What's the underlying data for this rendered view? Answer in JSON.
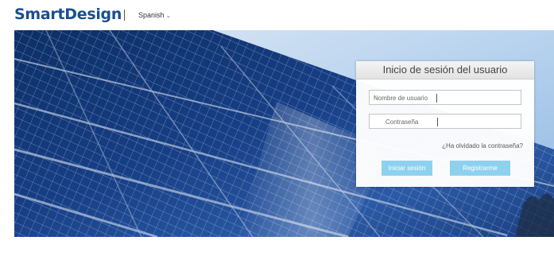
{
  "header": {
    "logo_text": "SmartDesign",
    "language": "Spanish",
    "language_chevron": "⌄"
  },
  "login": {
    "title": "Inicio de sesión del usuario",
    "username_placeholder": "Nombre de usuario",
    "password_placeholder": "Contraseña",
    "forgot_password": "¿Ha olvidado la contraseña?",
    "login_button": "Iniciar sesión",
    "register_button": "Registrarme"
  },
  "colors": {
    "brand": "#1a4f8f",
    "button": "#8ed1ef",
    "sky": "#b8d3ee",
    "panel_cell": "#10336e"
  }
}
